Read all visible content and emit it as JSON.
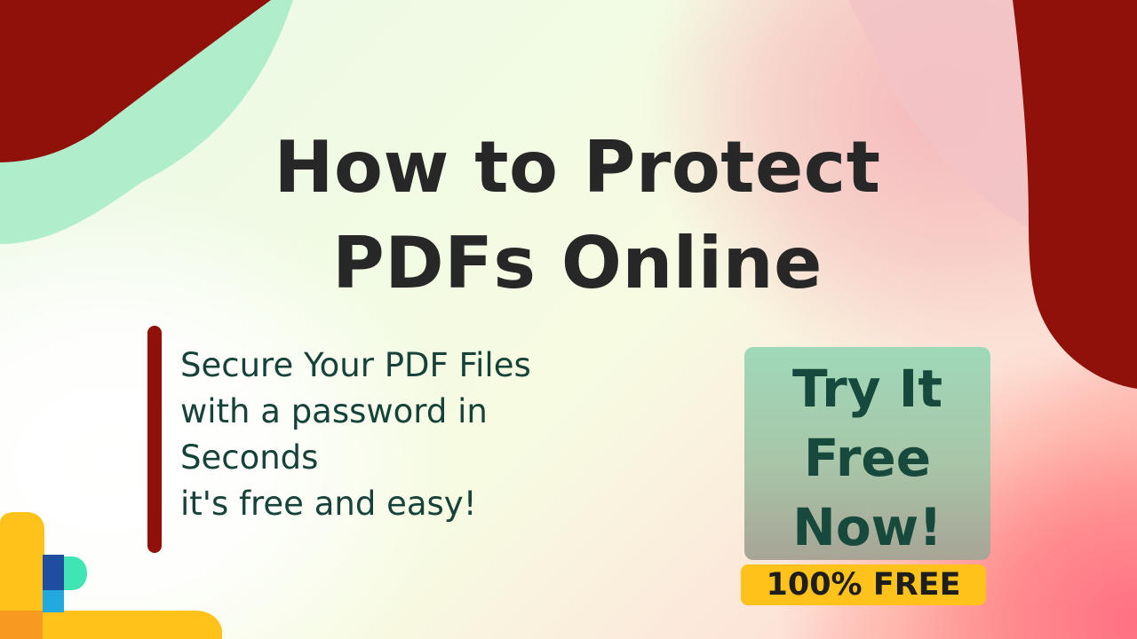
{
  "title": {
    "line1": "How to Protect",
    "line2": "PDFs Online"
  },
  "subtitle": {
    "line1": "Secure Your PDF Files",
    "line2": "with a password in",
    "line3": "Seconds",
    "line4": "it's free and easy!"
  },
  "cta": {
    "line1": "Try It",
    "line2": "Free",
    "line3": "Now!"
  },
  "badge": {
    "label": "100% FREE"
  },
  "colors": {
    "accent_red": "#8f1109",
    "title_text": "#272727",
    "body_text": "#17423a",
    "cta_text": "#17493d",
    "badge_yellow": "#ffc21a",
    "mint": "#a8ecc8"
  },
  "icons": {
    "logo": "pdf-tool-logo-icon"
  }
}
